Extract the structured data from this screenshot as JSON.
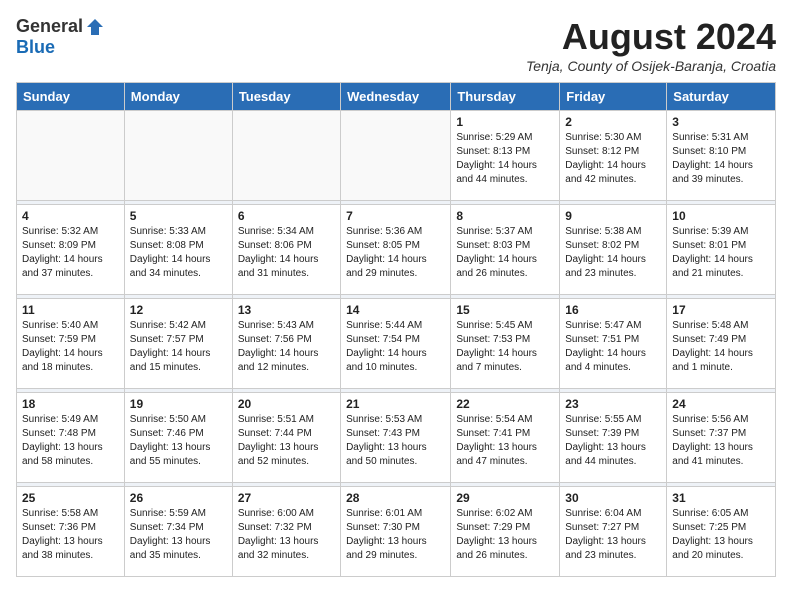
{
  "header": {
    "logo_general": "General",
    "logo_blue": "Blue",
    "month_year": "August 2024",
    "location": "Tenja, County of Osijek-Baranja, Croatia"
  },
  "weekdays": [
    "Sunday",
    "Monday",
    "Tuesday",
    "Wednesday",
    "Thursday",
    "Friday",
    "Saturday"
  ],
  "weeks": [
    [
      {
        "day": "",
        "info": ""
      },
      {
        "day": "",
        "info": ""
      },
      {
        "day": "",
        "info": ""
      },
      {
        "day": "",
        "info": ""
      },
      {
        "day": "1",
        "info": "Sunrise: 5:29 AM\nSunset: 8:13 PM\nDaylight: 14 hours\nand 44 minutes."
      },
      {
        "day": "2",
        "info": "Sunrise: 5:30 AM\nSunset: 8:12 PM\nDaylight: 14 hours\nand 42 minutes."
      },
      {
        "day": "3",
        "info": "Sunrise: 5:31 AM\nSunset: 8:10 PM\nDaylight: 14 hours\nand 39 minutes."
      }
    ],
    [
      {
        "day": "4",
        "info": "Sunrise: 5:32 AM\nSunset: 8:09 PM\nDaylight: 14 hours\nand 37 minutes."
      },
      {
        "day": "5",
        "info": "Sunrise: 5:33 AM\nSunset: 8:08 PM\nDaylight: 14 hours\nand 34 minutes."
      },
      {
        "day": "6",
        "info": "Sunrise: 5:34 AM\nSunset: 8:06 PM\nDaylight: 14 hours\nand 31 minutes."
      },
      {
        "day": "7",
        "info": "Sunrise: 5:36 AM\nSunset: 8:05 PM\nDaylight: 14 hours\nand 29 minutes."
      },
      {
        "day": "8",
        "info": "Sunrise: 5:37 AM\nSunset: 8:03 PM\nDaylight: 14 hours\nand 26 minutes."
      },
      {
        "day": "9",
        "info": "Sunrise: 5:38 AM\nSunset: 8:02 PM\nDaylight: 14 hours\nand 23 minutes."
      },
      {
        "day": "10",
        "info": "Sunrise: 5:39 AM\nSunset: 8:01 PM\nDaylight: 14 hours\nand 21 minutes."
      }
    ],
    [
      {
        "day": "11",
        "info": "Sunrise: 5:40 AM\nSunset: 7:59 PM\nDaylight: 14 hours\nand 18 minutes."
      },
      {
        "day": "12",
        "info": "Sunrise: 5:42 AM\nSunset: 7:57 PM\nDaylight: 14 hours\nand 15 minutes."
      },
      {
        "day": "13",
        "info": "Sunrise: 5:43 AM\nSunset: 7:56 PM\nDaylight: 14 hours\nand 12 minutes."
      },
      {
        "day": "14",
        "info": "Sunrise: 5:44 AM\nSunset: 7:54 PM\nDaylight: 14 hours\nand 10 minutes."
      },
      {
        "day": "15",
        "info": "Sunrise: 5:45 AM\nSunset: 7:53 PM\nDaylight: 14 hours\nand 7 minutes."
      },
      {
        "day": "16",
        "info": "Sunrise: 5:47 AM\nSunset: 7:51 PM\nDaylight: 14 hours\nand 4 minutes."
      },
      {
        "day": "17",
        "info": "Sunrise: 5:48 AM\nSunset: 7:49 PM\nDaylight: 14 hours\nand 1 minute."
      }
    ],
    [
      {
        "day": "18",
        "info": "Sunrise: 5:49 AM\nSunset: 7:48 PM\nDaylight: 13 hours\nand 58 minutes."
      },
      {
        "day": "19",
        "info": "Sunrise: 5:50 AM\nSunset: 7:46 PM\nDaylight: 13 hours\nand 55 minutes."
      },
      {
        "day": "20",
        "info": "Sunrise: 5:51 AM\nSunset: 7:44 PM\nDaylight: 13 hours\nand 52 minutes."
      },
      {
        "day": "21",
        "info": "Sunrise: 5:53 AM\nSunset: 7:43 PM\nDaylight: 13 hours\nand 50 minutes."
      },
      {
        "day": "22",
        "info": "Sunrise: 5:54 AM\nSunset: 7:41 PM\nDaylight: 13 hours\nand 47 minutes."
      },
      {
        "day": "23",
        "info": "Sunrise: 5:55 AM\nSunset: 7:39 PM\nDaylight: 13 hours\nand 44 minutes."
      },
      {
        "day": "24",
        "info": "Sunrise: 5:56 AM\nSunset: 7:37 PM\nDaylight: 13 hours\nand 41 minutes."
      }
    ],
    [
      {
        "day": "25",
        "info": "Sunrise: 5:58 AM\nSunset: 7:36 PM\nDaylight: 13 hours\nand 38 minutes."
      },
      {
        "day": "26",
        "info": "Sunrise: 5:59 AM\nSunset: 7:34 PM\nDaylight: 13 hours\nand 35 minutes."
      },
      {
        "day": "27",
        "info": "Sunrise: 6:00 AM\nSunset: 7:32 PM\nDaylight: 13 hours\nand 32 minutes."
      },
      {
        "day": "28",
        "info": "Sunrise: 6:01 AM\nSunset: 7:30 PM\nDaylight: 13 hours\nand 29 minutes."
      },
      {
        "day": "29",
        "info": "Sunrise: 6:02 AM\nSunset: 7:29 PM\nDaylight: 13 hours\nand 26 minutes."
      },
      {
        "day": "30",
        "info": "Sunrise: 6:04 AM\nSunset: 7:27 PM\nDaylight: 13 hours\nand 23 minutes."
      },
      {
        "day": "31",
        "info": "Sunrise: 6:05 AM\nSunset: 7:25 PM\nDaylight: 13 hours\nand 20 minutes."
      }
    ]
  ]
}
